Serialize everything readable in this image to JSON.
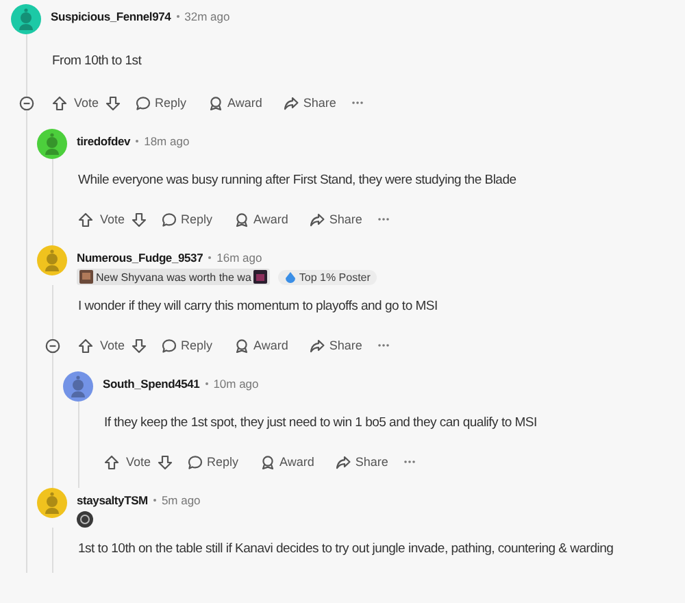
{
  "comments": [
    {
      "author": "Suspicious_Fennel974",
      "time": "32m ago",
      "color": "#1cc9a6",
      "body": "From 10th to 1st",
      "expanded": true,
      "actions": {
        "vote": "Vote",
        "reply": "Reply",
        "award": "Award",
        "share": "Share"
      },
      "children": [
        {
          "author": "tiredofdev",
          "time": "18m ago",
          "color": "#4ccf3c",
          "body": "While everyone was busy running after First Stand, they were studying the Blade",
          "actions": {
            "vote": "Vote",
            "reply": "Reply",
            "award": "Award",
            "share": "Share"
          }
        },
        {
          "author": "Numerous_Fudge_9537",
          "time": "16m ago",
          "color": "#f0c21e",
          "flairs": [
            {
              "kind": "emoji-text",
              "text": "New Shyvana was worth the wa"
            },
            {
              "kind": "badge",
              "text": "Top 1% Poster"
            }
          ],
          "body": "I wonder if they will carry this momentum to playoffs and go to MSI",
          "expanded": true,
          "actions": {
            "vote": "Vote",
            "reply": "Reply",
            "award": "Award",
            "share": "Share"
          },
          "children": [
            {
              "author": "South_Spend4541",
              "time": "10m ago",
              "color": "#7393e6",
              "body": "If they keep the 1st spot, they just need to win 1 bo5 and they can qualify to MSI",
              "actions": {
                "vote": "Vote",
                "reply": "Reply",
                "award": "Award",
                "share": "Share"
              }
            }
          ]
        },
        {
          "author": "staysaltyTSM",
          "time": "5m ago",
          "color": "#f0c21e",
          "flairs": [
            {
              "kind": "icon"
            }
          ],
          "body": "1st to 10th on the table still if Kanavi decides to try out jungle invade, pathing, countering & warding"
        }
      ]
    }
  ]
}
